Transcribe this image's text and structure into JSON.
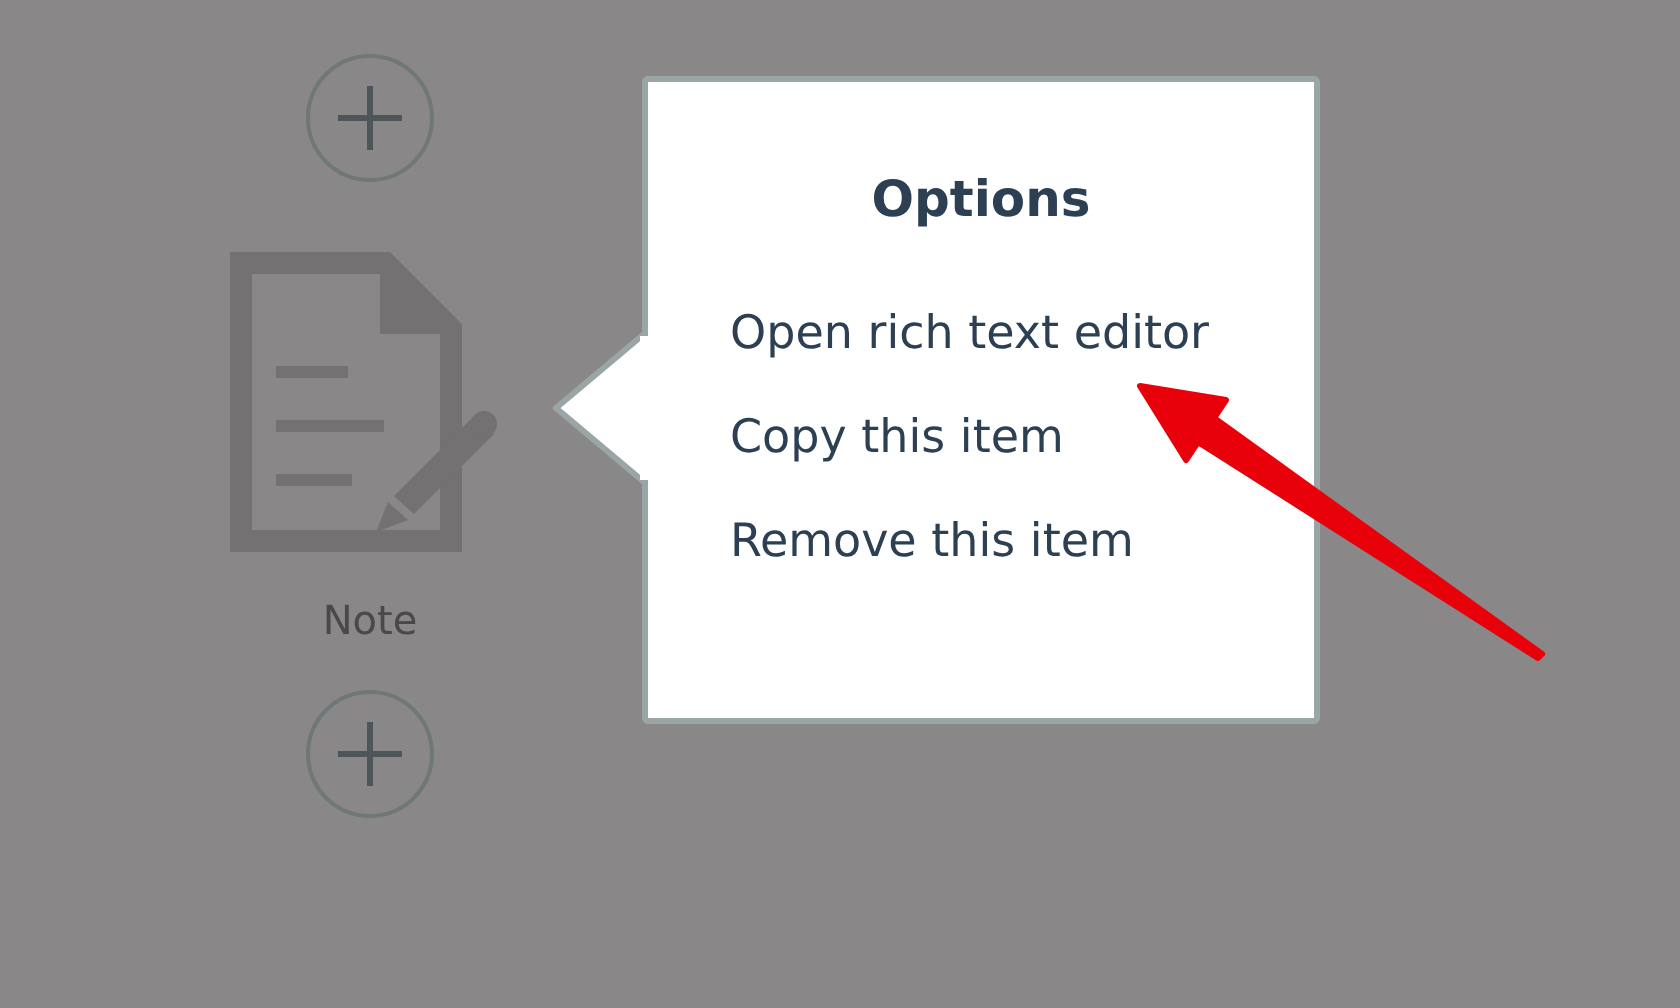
{
  "palette": [
    {
      "kind": "add"
    },
    {
      "kind": "item",
      "label": "Note"
    },
    {
      "kind": "add"
    }
  ],
  "popup": {
    "title": "Options",
    "items": [
      "Open rich text editor",
      "Copy this item",
      "Remove this item"
    ]
  }
}
